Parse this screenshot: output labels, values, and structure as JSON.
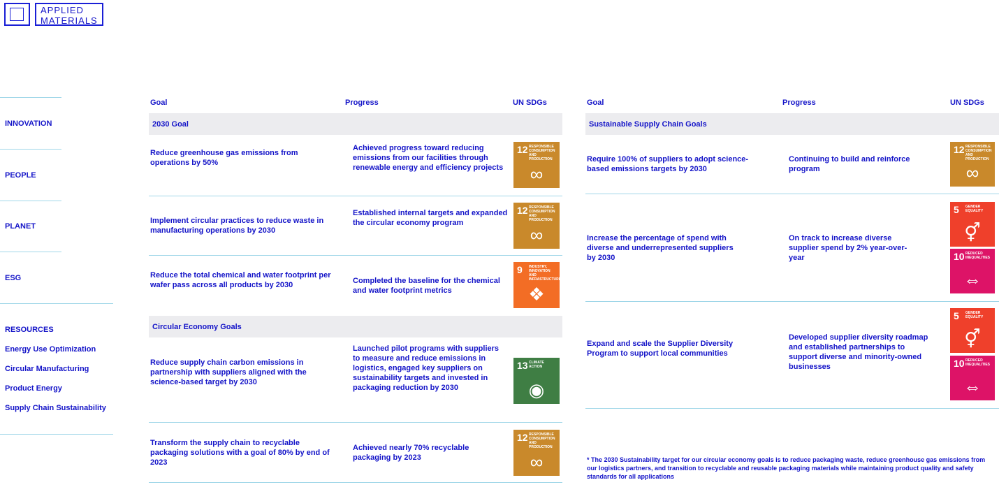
{
  "logo": {
    "line1": "APPLIED",
    "line2": "MATERIALS"
  },
  "sidebar": {
    "items": [
      {
        "label": "INNOVATION"
      },
      {
        "label": "PEOPLE"
      },
      {
        "label": "PLANET"
      },
      {
        "label": "ESG"
      },
      {
        "label": "RESOURCES"
      },
      {
        "label": "Energy Use Optimization"
      },
      {
        "label": "Circular Manufacturing"
      },
      {
        "label": "Product Energy"
      },
      {
        "label": "Supply Chain Sustainability"
      }
    ]
  },
  "left_table": {
    "headers": {
      "goal": "Goal",
      "progress": "Progress",
      "sdg": "UN SDGs"
    },
    "sections": [
      {
        "label": "2030 Goal"
      },
      {
        "label": "Circular Economy Goals"
      }
    ],
    "rows": [
      {
        "goal": "Reduce greenhouse gas emissions from operations by 50%",
        "progress": "Achieved progress toward reducing emissions from our facilities through renewable energy and efficiency projects",
        "sdgs": [
          "12"
        ]
      },
      {
        "goal": "Implement circular practices to reduce waste in manufacturing operations by 2030",
        "progress": "Established internal targets and expanded the circular economy program",
        "sdgs": [
          "12"
        ]
      },
      {
        "goal": "Reduce the total chemical and water footprint per wafer pass across all products by 2030",
        "progress": "Completed the baseline for the chemical and water footprint metrics",
        "sdgs": [
          "9"
        ]
      },
      {
        "goal": "Reduce supply chain carbon emissions in partnership with suppliers aligned with the science-based target by 2030",
        "progress": "Launched pilot programs with suppliers to measure and reduce emissions in logistics, engaged key suppliers on sustainability targets and invested in packaging reduction by 2030",
        "sdgs": [
          "13"
        ]
      },
      {
        "goal": "Transform the supply chain to recyclable packaging solutions with a goal of 80% by end of 2023",
        "progress": "Achieved nearly 70% recyclable packaging by 2023",
        "sdgs": [
          "12"
        ]
      }
    ]
  },
  "right_table": {
    "headers": {
      "goal": "Goal",
      "progress": "Progress",
      "sdg": "UN SDGs"
    },
    "sections": [
      {
        "label": "Sustainable Supply Chain Goals"
      }
    ],
    "rows": [
      {
        "goal": "Require 100% of suppliers to adopt science-based emissions targets by 2030",
        "progress": "Continuing to build and reinforce program",
        "sdgs": [
          "12"
        ]
      },
      {
        "goal": "Increase the percentage of spend with diverse and underrepresented suppliers by 2030",
        "progress": "On track to increase diverse supplier spend by 2% year-over-year",
        "sdgs": [
          "5",
          "10"
        ]
      },
      {
        "goal": "Expand and scale the Supplier Diversity Program to support local communities",
        "progress": "Developed supplier diversity roadmap and established partnerships to support diverse and minority-owned businesses",
        "sdgs": [
          "5",
          "10"
        ]
      }
    ],
    "footnote": "* The 2030 Sustainability target for our circular economy goals is to reduce packaging waste, reduce greenhouse gas emissions from our logistics partners, and transition to recyclable and reusable packaging materials while maintaining product quality and safety standards for all applications"
  },
  "sdg_tiles": {
    "12": {
      "num": "12",
      "label": "Responsible consumption and production",
      "color": "#c9892b",
      "icon": "infinity-icon"
    },
    "9": {
      "num": "9",
      "label": "Industry, innovation and infrastructure",
      "color": "#f36d25",
      "icon": "cubes-icon"
    },
    "13": {
      "num": "13",
      "label": "Climate action",
      "color": "#3f7e44",
      "icon": "eye-icon"
    },
    "5": {
      "num": "5",
      "label": "Gender equality",
      "color": "#ef402b",
      "icon": "gender-icon"
    },
    "10": {
      "num": "10",
      "label": "Reduced inequalities",
      "color": "#dd1367",
      "icon": "equality-icon"
    }
  }
}
